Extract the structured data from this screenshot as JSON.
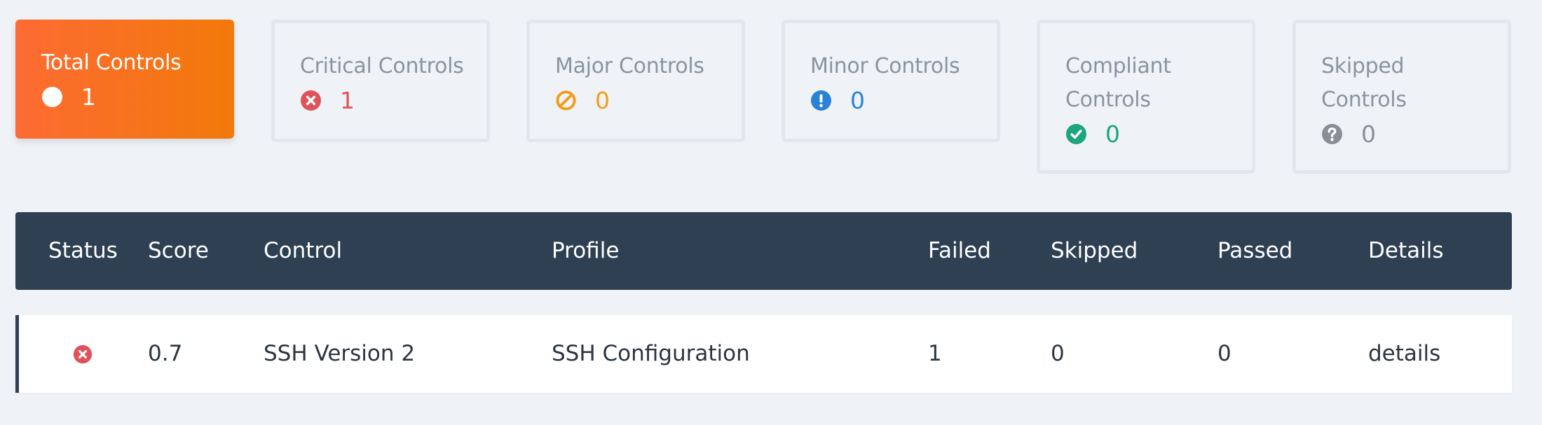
{
  "filters": {
    "total": {
      "label": "Total Controls",
      "count": "1",
      "icon": "circle-icon",
      "color": "#ffffff"
    },
    "critical": {
      "label": "Critical Controls",
      "count": "1",
      "icon": "x-circle-icon",
      "color": "#e0525a"
    },
    "major": {
      "label": "Major Controls",
      "count": "0",
      "icon": "ban-icon",
      "color": "#f39c19"
    },
    "minor": {
      "label": "Minor Controls",
      "count": "0",
      "icon": "exclamation-circle-icon",
      "color": "#2a82d4"
    },
    "compliant": {
      "label_line1": "Compliant",
      "label_line2": "Controls",
      "count": "0",
      "icon": "check-circle-icon",
      "color": "#1ea57e"
    },
    "skipped": {
      "label_line1": "Skipped",
      "label_line2": "Controls",
      "count": "0",
      "icon": "question-circle-icon",
      "color": "#8a8f96"
    }
  },
  "table": {
    "headers": {
      "status": "Status",
      "score": "Score",
      "control": "Control",
      "profile": "Profile",
      "failed": "Failed",
      "skipped": "Skipped",
      "passed": "Passed",
      "details": "Details"
    },
    "rows": [
      {
        "status_icon": "x-circle-icon",
        "score": "0.7",
        "control": "SSH Version 2",
        "profile": "SSH Configuration",
        "failed": "1",
        "skipped": "0",
        "passed": "0",
        "details": "details"
      }
    ]
  }
}
